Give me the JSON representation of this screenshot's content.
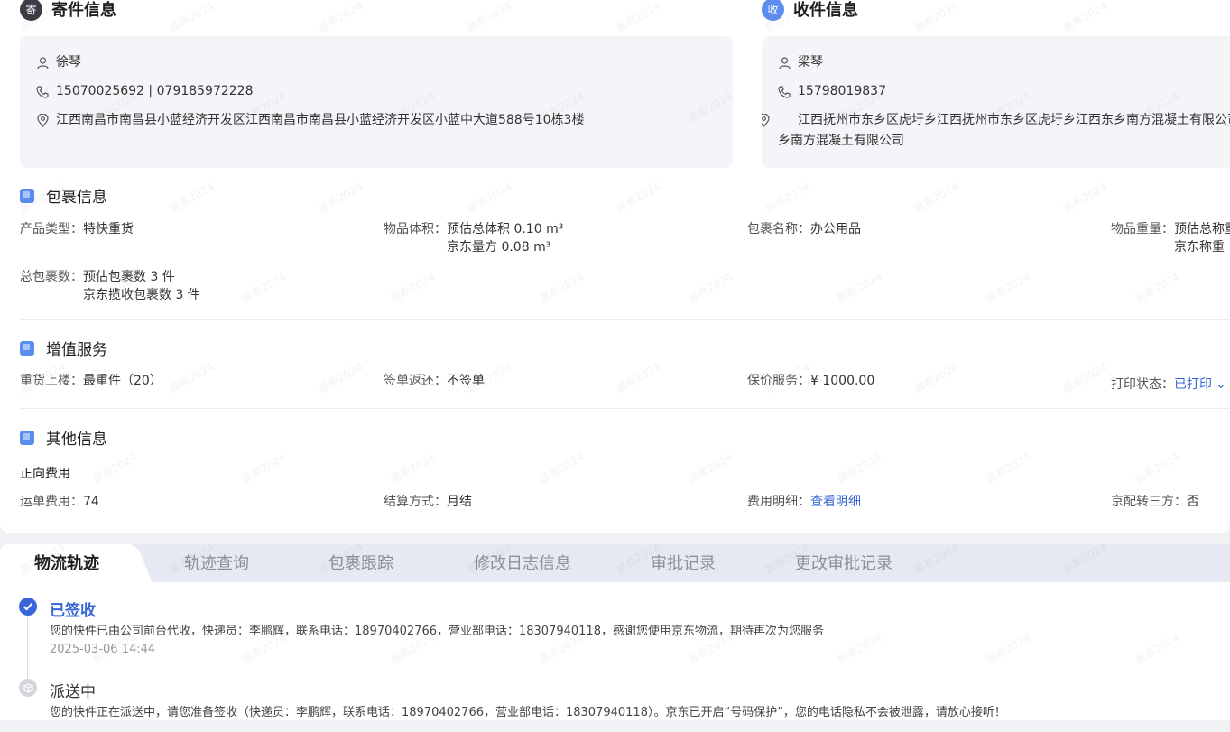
{
  "sender": {
    "badge": "寄",
    "title": "寄件信息",
    "name": "徐琴",
    "phone": "15070025692 | 079185972228",
    "address": "江西南昌市南昌县小蓝经济开发区江西南昌市南昌县小蓝经济开发区小蓝中大道588号10栋3楼"
  },
  "receiver": {
    "badge": "收",
    "title": "收件信息",
    "name": "梁琴",
    "phone": "15798019837",
    "address": "江西抚州市东乡区虎圩乡江西抚州市东乡区虎圩乡江西东乡南方混凝土有限公司东乡南方混凝土有限公司"
  },
  "package": {
    "title": "包裹信息",
    "product_type": {
      "label": "产品类型：",
      "value": "特快重货"
    },
    "volume": {
      "label": "物品体积：",
      "value1": "预估总体积 0.10 m³",
      "value2": "京东量方 0.08 m³"
    },
    "name": {
      "label": "包裹名称：",
      "value": "办公用品"
    },
    "weight": {
      "label": "物品重量：",
      "value1": "预估总称重",
      "value2": "京东称重"
    },
    "count": {
      "label": "总包裹数：",
      "value1": "预估包裹数 3 件",
      "value2": "京东揽收包裹数 3 件"
    }
  },
  "services": {
    "title": "增值服务",
    "upstairs": {
      "label": "重货上楼：",
      "value": "最重件（20）"
    },
    "sign_return": {
      "label": "签单返还：",
      "value": "不签单"
    },
    "insurance": {
      "label": "保价服务：",
      "value": "¥ 1000.00"
    },
    "print_status": {
      "label": "打印状态：",
      "value": "已打印"
    }
  },
  "other": {
    "title": "其他信息",
    "forward_fee": "正向费用",
    "waybill_fee": {
      "label": "运单费用：",
      "value": "74"
    },
    "settlement": {
      "label": "结算方式：",
      "value": "月结"
    },
    "fee_detail": {
      "label": "费用明细：",
      "value": "查看明细"
    },
    "third_party": {
      "label": "京配转三方：",
      "value": "否"
    }
  },
  "tabs": [
    "物流轨迹",
    "轨迹查询",
    "包裹跟踪",
    "修改日志信息",
    "审批记录",
    "更改审批记录"
  ],
  "timeline": [
    {
      "status": "已签收",
      "desc": "您的快件已由公司前台代收，快递员：李鹏辉，联系电话：18970402766，营业部电话：18307940118，感谢您使用京东物流，期待再次为您服务",
      "time": "2025-03-06 14:44"
    },
    {
      "status": "派送中",
      "desc": "您的快件正在派送中，请您准备签收（快递员：李鹏辉，联系电话：18970402766，营业部电话：18307940118）。京东已开启“号码保护”，您的电话隐私不会被泄露，请放心接听！"
    }
  ],
  "watermark": "晨希2024",
  "colors": {
    "accent": "#3866d8",
    "badge_dark": "#3a3d46",
    "badge_blue": "#5b8def"
  }
}
